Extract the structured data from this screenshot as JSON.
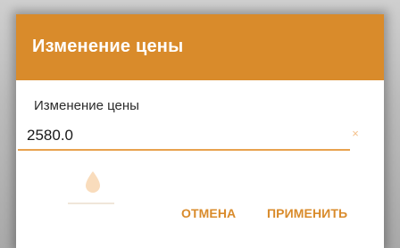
{
  "dialog": {
    "title": "Изменение цены",
    "field_label": "Изменение цены",
    "price_value": "2580.0",
    "clear_icon": "×",
    "cancel_label": "ОТМЕНА",
    "apply_label": "ПРИМЕНИТЬ"
  },
  "icons": {
    "clear": "close-icon",
    "cursor_handle": "text-cursor-drop-handle"
  },
  "colors": {
    "accent": "#d98b2b",
    "underline": "#e8a24e",
    "handle": "#f9dcbc",
    "clear_icon": "#f4c08a"
  }
}
